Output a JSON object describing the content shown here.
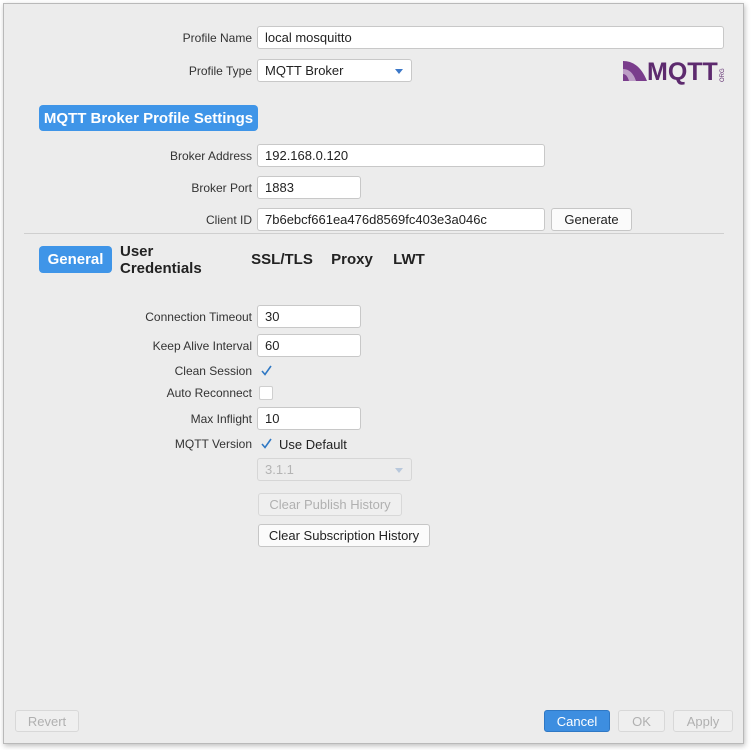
{
  "profile": {
    "name_label": "Profile Name",
    "name_value": "local mosquitto",
    "type_label": "Profile Type",
    "type_value": "MQTT Broker",
    "logo_text": "MQTT",
    "logo_suffix": "ORG"
  },
  "broker_section": {
    "title": "MQTT Broker Profile Settings",
    "address_label": "Broker Address",
    "address_value": "192.168.0.120",
    "port_label": "Broker Port",
    "port_value": "1883",
    "client_id_label": "Client ID",
    "client_id_value": "7b6ebcf661ea476d8569fc403e3a046c",
    "generate_label": "Generate"
  },
  "tabs": [
    {
      "label": "General",
      "active": true
    },
    {
      "label": "User Credentials",
      "active": false
    },
    {
      "label": "SSL/TLS",
      "active": false
    },
    {
      "label": "Proxy",
      "active": false
    },
    {
      "label": "LWT",
      "active": false
    }
  ],
  "general": {
    "connection_timeout_label": "Connection Timeout",
    "connection_timeout_value": "30",
    "keep_alive_label": "Keep Alive Interval",
    "keep_alive_value": "60",
    "clean_session_label": "Clean Session",
    "clean_session_checked": true,
    "auto_reconnect_label": "Auto Reconnect",
    "auto_reconnect_checked": false,
    "max_inflight_label": "Max Inflight",
    "max_inflight_value": "10",
    "mqtt_version_label": "MQTT Version",
    "use_default_label": "Use Default",
    "use_default_checked": true,
    "version_value": "3.1.1",
    "clear_publish_label": "Clear Publish History",
    "clear_subscription_label": "Clear Subscription History"
  },
  "footer": {
    "revert_label": "Revert",
    "cancel_label": "Cancel",
    "ok_label": "OK",
    "apply_label": "Apply"
  },
  "colors": {
    "accent": "#3f95e8",
    "logo_purple": "#5d2a6e",
    "check_blue": "#2f78c4"
  }
}
